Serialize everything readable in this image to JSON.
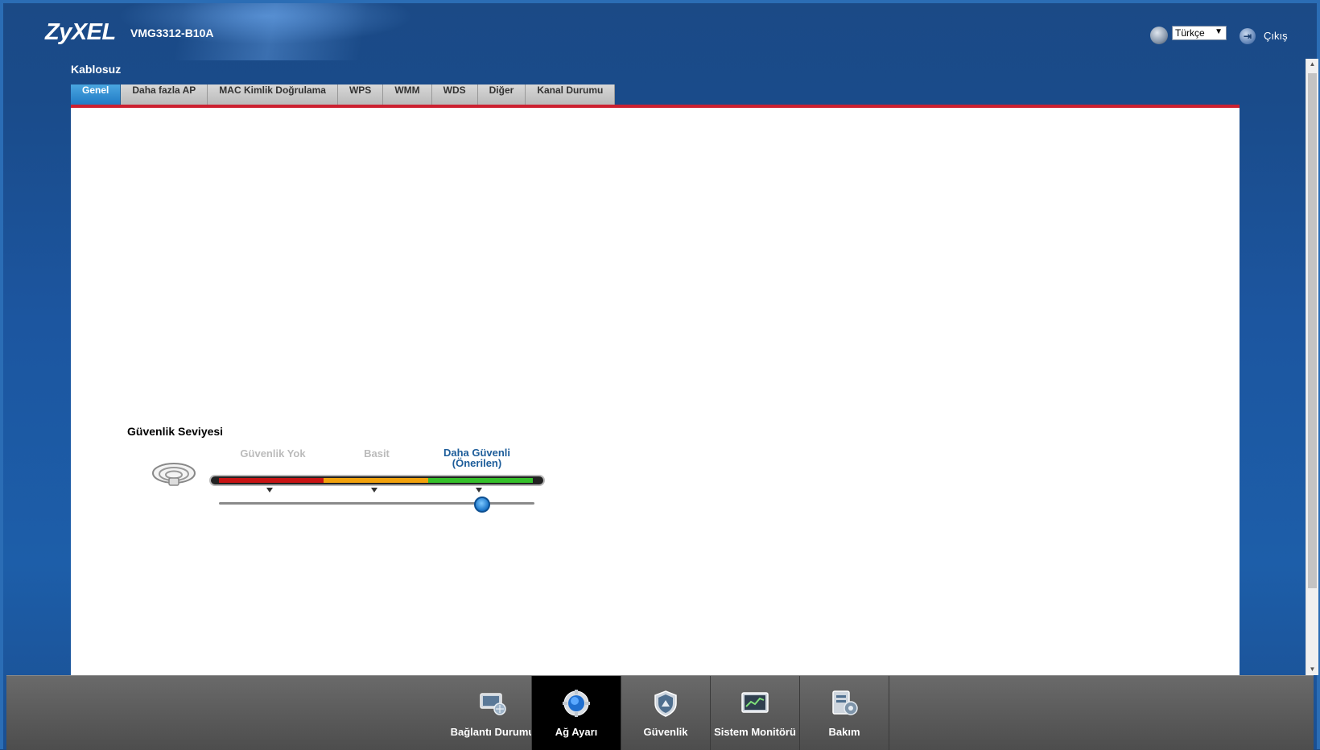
{
  "header": {
    "logo": "ZyXEL",
    "model": "VMG3312-B10A",
    "language": "Türkçe",
    "logout_label": "Çıkış"
  },
  "section_title": "Kablosuz",
  "tabs": [
    {
      "label": "Genel",
      "active": true
    },
    {
      "label": "Daha fazla AP"
    },
    {
      "label": "MAC Kimlik Doğrulama"
    },
    {
      "label": "WPS"
    },
    {
      "label": "WMM"
    },
    {
      "label": "WDS"
    },
    {
      "label": "Diğer"
    },
    {
      "label": "Kanal Durumu"
    }
  ],
  "security": {
    "title": "Güvenlik Seviyesi",
    "levels": [
      "Güvenlik Yok",
      "Basit",
      "Daha Güvenli",
      "(Önerilen)"
    ],
    "selected_level": 3
  },
  "bottom_nav": [
    {
      "label": "Bağlantı Durumu",
      "icon": "connection-status-icon"
    },
    {
      "label": "Ağ Ayarı",
      "icon": "gear-icon",
      "active": true
    },
    {
      "label": "Güvenlik",
      "icon": "shield-icon"
    },
    {
      "label": "Sistem Monitörü",
      "icon": "monitor-chart-icon"
    },
    {
      "label": "Bakım",
      "icon": "maintenance-icon"
    }
  ],
  "colors": {
    "accent_tab": "#2a8bd1",
    "red_line": "#cc2030",
    "level_red": "#c81414",
    "level_yellow": "#f2a20c",
    "level_green": "#35c02a"
  }
}
